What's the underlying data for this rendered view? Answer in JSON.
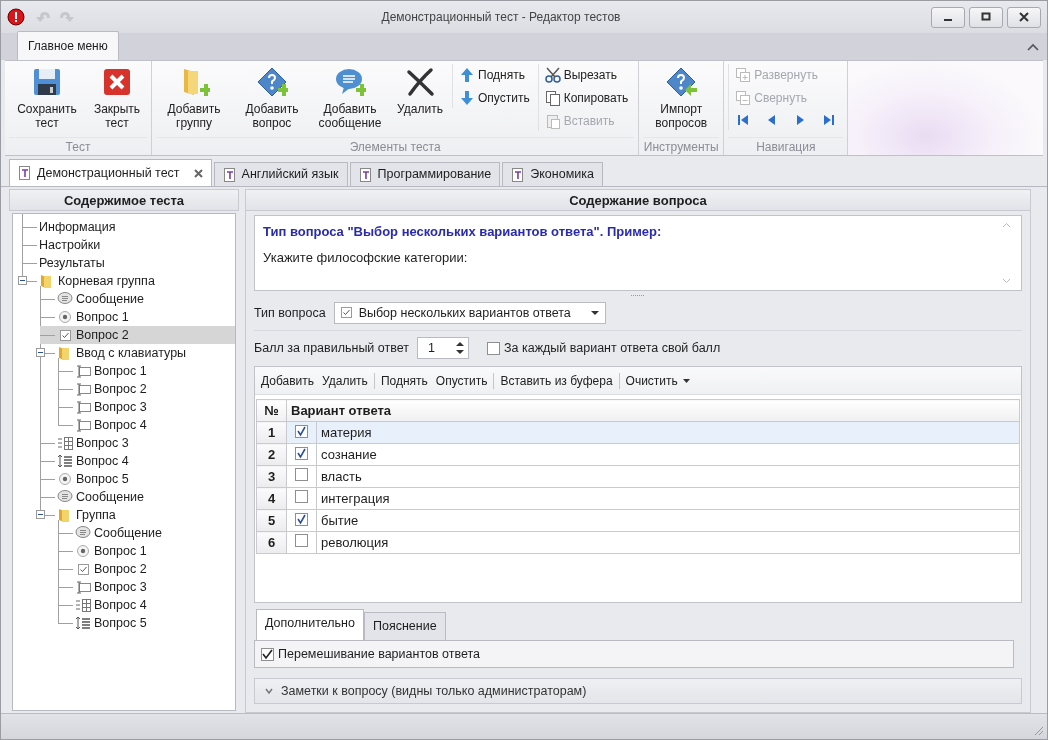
{
  "window": {
    "title": "Демонстрационный тест - Редактор тестов"
  },
  "ribbon": {
    "tabs": [
      {
        "label": "Главное меню",
        "selected": true
      }
    ],
    "groups": [
      {
        "label": "Тест",
        "items": [
          {
            "kind": "large",
            "label": "Сохранить тест",
            "disabled": false
          },
          {
            "kind": "large",
            "label": "Закрыть тест",
            "disabled": false
          }
        ]
      },
      {
        "label": "Элементы теста",
        "items": [
          {
            "kind": "large",
            "label": "Добавить группу",
            "disabled": false
          },
          {
            "kind": "large",
            "label": "Добавить вопрос",
            "disabled": false
          },
          {
            "kind": "large",
            "label": "Добавить сообщение",
            "disabled": false
          },
          {
            "kind": "large",
            "label": "Удалить",
            "disabled": false
          },
          {
            "kind": "small",
            "label": "Поднять",
            "disabled": false
          },
          {
            "kind": "small",
            "label": "Опустить",
            "disabled": false
          },
          {
            "kind": "small",
            "label": "Вырезать",
            "disabled": false
          },
          {
            "kind": "small",
            "label": "Копировать",
            "disabled": false
          },
          {
            "kind": "small",
            "label": "Вставить",
            "disabled": true
          }
        ]
      },
      {
        "label": "Инструменты",
        "items": [
          {
            "kind": "large",
            "label": "Импорт вопросов",
            "disabled": false
          }
        ]
      },
      {
        "label": "Навигация",
        "items": [
          {
            "kind": "small",
            "label": "Развернуть",
            "disabled": true
          },
          {
            "kind": "small",
            "label": "Свернуть",
            "disabled": true
          },
          {
            "kind": "nav",
            "disabled": false
          }
        ]
      }
    ]
  },
  "doc_tabs": [
    {
      "label": "Демонстрационный тест",
      "selected": true,
      "closable": true
    },
    {
      "label": "Английский язык",
      "selected": false,
      "closable": false
    },
    {
      "label": "Программирование",
      "selected": false,
      "closable": false
    },
    {
      "label": "Экономика",
      "selected": false,
      "closable": false
    }
  ],
  "tree": {
    "title": "Содержимое теста",
    "items": [
      {
        "kind": "plain",
        "label": "Информация",
        "selected": false
      },
      {
        "kind": "plain",
        "label": "Настройки",
        "selected": false
      },
      {
        "kind": "plain",
        "label": "Результаты",
        "selected": false
      },
      {
        "kind": "folder",
        "label": "Корневая группа",
        "selected": false,
        "expanded": true,
        "children": [
          {
            "kind": "message",
            "label": "Сообщение",
            "selected": false
          },
          {
            "kind": "radio",
            "label": "Вопрос 1",
            "selected": false
          },
          {
            "kind": "checkbox",
            "label": "Вопрос 2",
            "selected": true
          },
          {
            "kind": "folder",
            "label": "Ввод с клавиатуры",
            "selected": false,
            "expanded": true,
            "children": [
              {
                "kind": "text",
                "label": "Вопрос 1",
                "selected": false
              },
              {
                "kind": "text",
                "label": "Вопрос 2",
                "selected": false
              },
              {
                "kind": "text",
                "label": "Вопрос 3",
                "selected": false
              },
              {
                "kind": "text",
                "label": "Вопрос 4",
                "selected": false
              }
            ]
          },
          {
            "kind": "matching",
            "label": "Вопрос 3",
            "selected": false
          },
          {
            "kind": "ordering",
            "label": "Вопрос 4",
            "selected": false
          },
          {
            "kind": "radio",
            "label": "Вопрос 5",
            "selected": false
          },
          {
            "kind": "message",
            "label": "Сообщение",
            "selected": false
          },
          {
            "kind": "folder",
            "label": "Группа",
            "selected": false,
            "expanded": true,
            "children": [
              {
                "kind": "message",
                "label": "Сообщение",
                "selected": false
              },
              {
                "kind": "radio",
                "label": "Вопрос 1",
                "selected": false
              },
              {
                "kind": "checkbox",
                "label": "Вопрос 2",
                "selected": false
              },
              {
                "kind": "text",
                "label": "Вопрос 3",
                "selected": false
              },
              {
                "kind": "matching",
                "label": "Вопрос 4",
                "selected": false
              },
              {
                "kind": "ordering",
                "label": "Вопрос 5",
                "selected": false
              }
            ]
          }
        ]
      }
    ]
  },
  "question": {
    "title": "Содержание вопроса",
    "heading": "Тип вопроса \"Выбор нескольких вариантов ответа\". Пример:",
    "text": "Укажите философские категории:",
    "type_label": "Тип вопроса",
    "type_value": "Выбор нескольких вариантов ответа",
    "score_label": "Балл за правильный ответ",
    "score_value": "1",
    "per_variant": {
      "label": "За каждый вариант ответа свой балл",
      "checked": false
    },
    "toolbar": [
      [
        {
          "label": "Добавить",
          "dropdown": false
        },
        {
          "label": "Удалить",
          "dropdown": false
        }
      ],
      [
        {
          "label": "Поднять",
          "dropdown": false
        },
        {
          "label": "Опустить",
          "dropdown": false
        }
      ],
      [
        {
          "label": "Вставить из буфера",
          "dropdown": false
        }
      ],
      [
        {
          "label": "Очистить",
          "dropdown": true
        }
      ]
    ],
    "table": {
      "columns": [
        "№",
        "Вариант ответа"
      ],
      "rows": [
        {
          "num": "1",
          "checked": true,
          "text": "материя",
          "selected": true
        },
        {
          "num": "2",
          "checked": true,
          "text": "сознание",
          "selected": false
        },
        {
          "num": "3",
          "checked": false,
          "text": "власть",
          "selected": false
        },
        {
          "num": "4",
          "checked": false,
          "text": "интеграция",
          "selected": false
        },
        {
          "num": "5",
          "checked": true,
          "text": "бытие",
          "selected": false
        },
        {
          "num": "6",
          "checked": false,
          "text": "революция",
          "selected": false
        }
      ]
    },
    "tabs": [
      {
        "label": "Дополнительно",
        "selected": true
      },
      {
        "label": "Пояснение",
        "selected": false
      }
    ],
    "shuffle": {
      "label": "Перемешивание вариантов ответа",
      "checked": true
    },
    "notes": {
      "label": "Заметки к вопросу (видны только администраторам)",
      "expanded": false
    }
  }
}
